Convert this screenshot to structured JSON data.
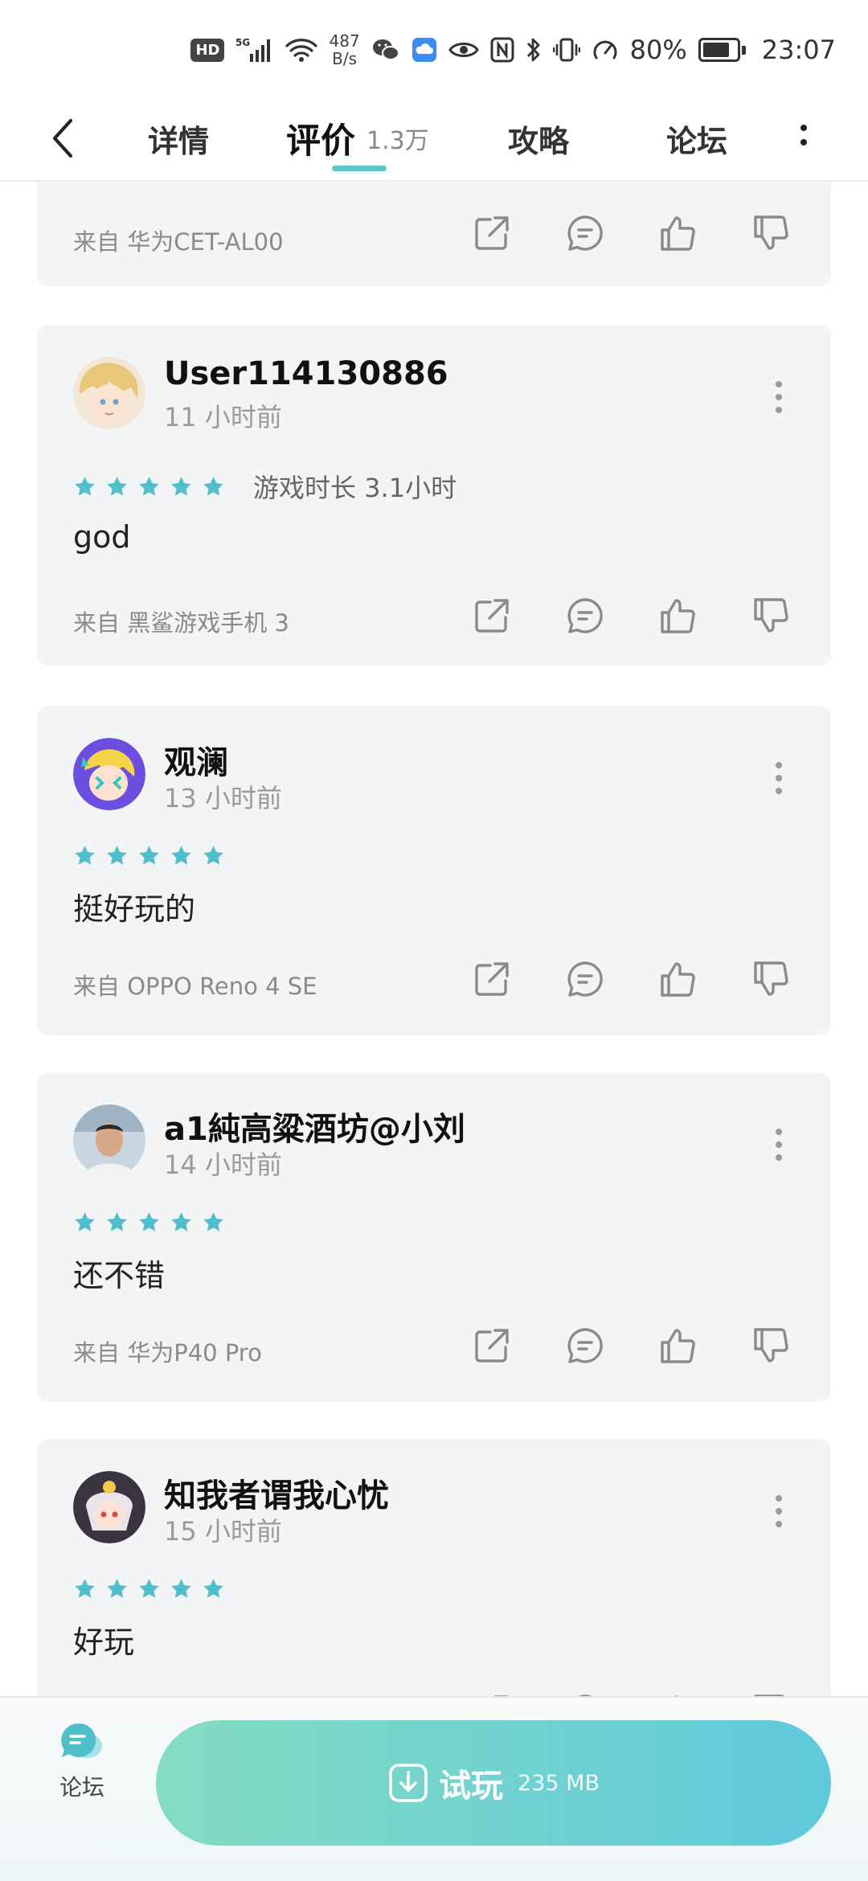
{
  "status": {
    "hd": "HD",
    "net_speed_value": "487",
    "net_speed_unit": "B/s",
    "battery_pct": "80%",
    "battery_level": 0.8,
    "time": "23:07"
  },
  "nav": {
    "tabs": [
      {
        "label": "详情"
      },
      {
        "label": "评价",
        "count": "1.3万"
      },
      {
        "label": "攻略"
      },
      {
        "label": "论坛"
      }
    ]
  },
  "reviews": [
    {
      "device": "来自 华为CET-AL00"
    },
    {
      "username": "User114130886",
      "time": "11 小时前",
      "rating": 5,
      "playtime": "游戏时长 3.1小时",
      "text": "god",
      "device": "来自 黑鲨游戏手机 3"
    },
    {
      "username": "观澜",
      "time": "13 小时前",
      "rating": 5,
      "text": "挺好玩的",
      "device": "来自 OPPO Reno 4 SE"
    },
    {
      "username": "a1純高粱酒坊@小刘",
      "time": "14 小时前",
      "rating": 5,
      "text": "还不错",
      "device": "来自 华为P40 Pro"
    },
    {
      "username": "知我者谓我心忧",
      "time": "15 小时前",
      "rating": 5,
      "text": "好玩"
    }
  ],
  "bottom": {
    "forum_label": "论坛",
    "trial_label": "试玩",
    "trial_size": "235 MB"
  },
  "colors": {
    "accent": "#5bc4cc",
    "star": "#4fbfc9",
    "card_bg": "#f3f4f6"
  }
}
